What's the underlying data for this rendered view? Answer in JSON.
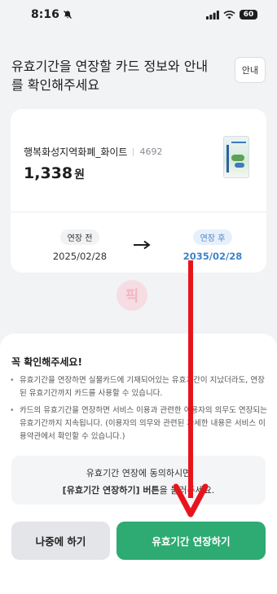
{
  "status_bar": {
    "time": "8:16",
    "battery": "60"
  },
  "header": {
    "title": "유효기간을 연장할 카드 정보와 안내를 확인해주세요",
    "guide_label": "안내"
  },
  "card": {
    "name": "행복화성지역화폐_화이트",
    "number": "4692",
    "balance": "1,338",
    "balance_unit": "원"
  },
  "period": {
    "before_label": "연장 전",
    "before_date": "2025/02/28",
    "after_label": "연장 후",
    "after_date": "2035/02/28"
  },
  "watermark": "픽",
  "notice": {
    "title": "꼭 확인해주세요!",
    "items": [
      "유효기간을 연장하면 실물카드에 기재되어있는 유효기간이 지났더라도, 연장된 유효기간까지 카드를 사용할 수 있습니다.",
      "카드의 유효기간을 연장하면 서비스 이용과 관련한 이용자의 의무도 연장되는 유효기간까지 지속됩니다. (이용자의 의무와 관련된 자세한 내용은 서비스 이용약관에서 확인할 수 있습니다.)"
    ]
  },
  "consent": {
    "line1": "유효기간 연장에 동의하시면",
    "line2_strong": "[유효기간 연장하기] 버튼",
    "line2_rest": "을 눌러주세요."
  },
  "buttons": {
    "later": "나중에 하기",
    "extend": "유효기간 연장하기"
  },
  "colors": {
    "accent_green": "#2eaa73",
    "after_date_blue": "#3f83c9",
    "annotation_red": "#e8141c"
  }
}
